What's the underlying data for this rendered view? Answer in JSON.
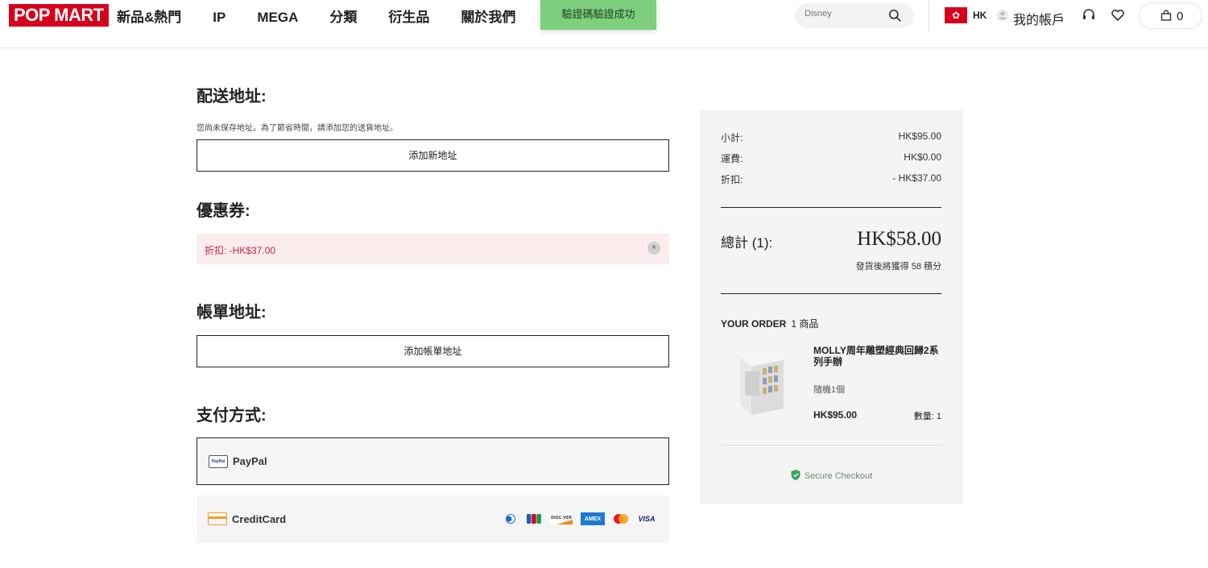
{
  "header": {
    "logo": "POP MART",
    "nav": [
      "新品&熱門",
      "IP",
      "MEGA",
      "分類",
      "衍生品",
      "關於我們"
    ],
    "toast": "驗證碼驗證成功",
    "search_placeholder": "Disney",
    "region": "HK",
    "account": "我的帳戶",
    "cart_count": "0"
  },
  "shipping": {
    "title": "配送地址:",
    "note": "您尚未保存地址。為了節省時間，請添加您的送貨地址。",
    "add_button": "添加新地址"
  },
  "coupon": {
    "title": "優惠券:",
    "applied": "折扣: -HK$37.00",
    "close": "×"
  },
  "billing": {
    "title": "帳單地址:",
    "add_button": "添加帳單地址"
  },
  "payment": {
    "title": "支付方式:",
    "options": [
      {
        "label": "PayPal",
        "icon": "paypal-icon",
        "icon_text": "PayPal",
        "selected": true
      },
      {
        "label": "CreditCard",
        "icon": "credit-card-icon",
        "selected": false
      }
    ],
    "brands": [
      "Diners",
      "JCB",
      "DISCOVER",
      "AMEX",
      "Mastercard",
      "VISA"
    ]
  },
  "summary": {
    "subtotal_label": "小計:",
    "subtotal_value": "HK$95.00",
    "shipping_label": "運費:",
    "shipping_value": "HK$0.00",
    "discount_label": "折扣:",
    "discount_value": "- HK$37.00",
    "total_label": "總計 (1):",
    "total_value": "HK$58.00",
    "points_note": "發貨後將獲得 58 積分",
    "order_title": "YOUR ORDER",
    "order_count": "1 商品",
    "product": {
      "name": "MOLLY周年雕塑經典回歸2系列手辦",
      "variant": "隨機1個",
      "price": "HK$95.00",
      "qty": "數量: 1"
    },
    "secure": "Secure Checkout"
  },
  "colors": {
    "brand_red": "#d6001c",
    "toast_green": "#7dcf7d",
    "coupon_bg": "#fbecee",
    "coupon_text": "#c8264b",
    "summary_bg": "#f4f4f4"
  }
}
